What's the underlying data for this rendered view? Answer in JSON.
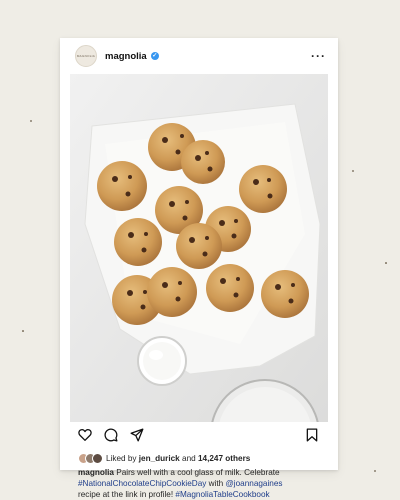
{
  "post": {
    "username": "magnolia",
    "avatar_text": "MAGNOLIA",
    "verified": true,
    "more_icon": "more-horizontal-icon",
    "liked_by_prefix": "Liked by",
    "liked_by_user": "jen_durick",
    "liked_by_and": "and",
    "liked_by_count": "14,247 others",
    "caption": {
      "username": "magnolia",
      "text_1": "Pairs well with a cool glass of milk. Celebrate",
      "hashtag_1": "#NationalChocolateChipCookieDay",
      "text_2": "with",
      "mention": "@joannagaines",
      "text_3": "recipe at the link in profile!",
      "hashtag_2": "#MagnoliaTableCookbook"
    }
  },
  "actions": {
    "like_icon": "heart-icon",
    "comment_icon": "comment-icon",
    "share_icon": "send-icon",
    "save_icon": "bookmark-icon"
  },
  "colors": {
    "background": "#efede6",
    "card": "#ffffff",
    "verified_badge": "#3897f0",
    "link": "#1f3e8a"
  }
}
